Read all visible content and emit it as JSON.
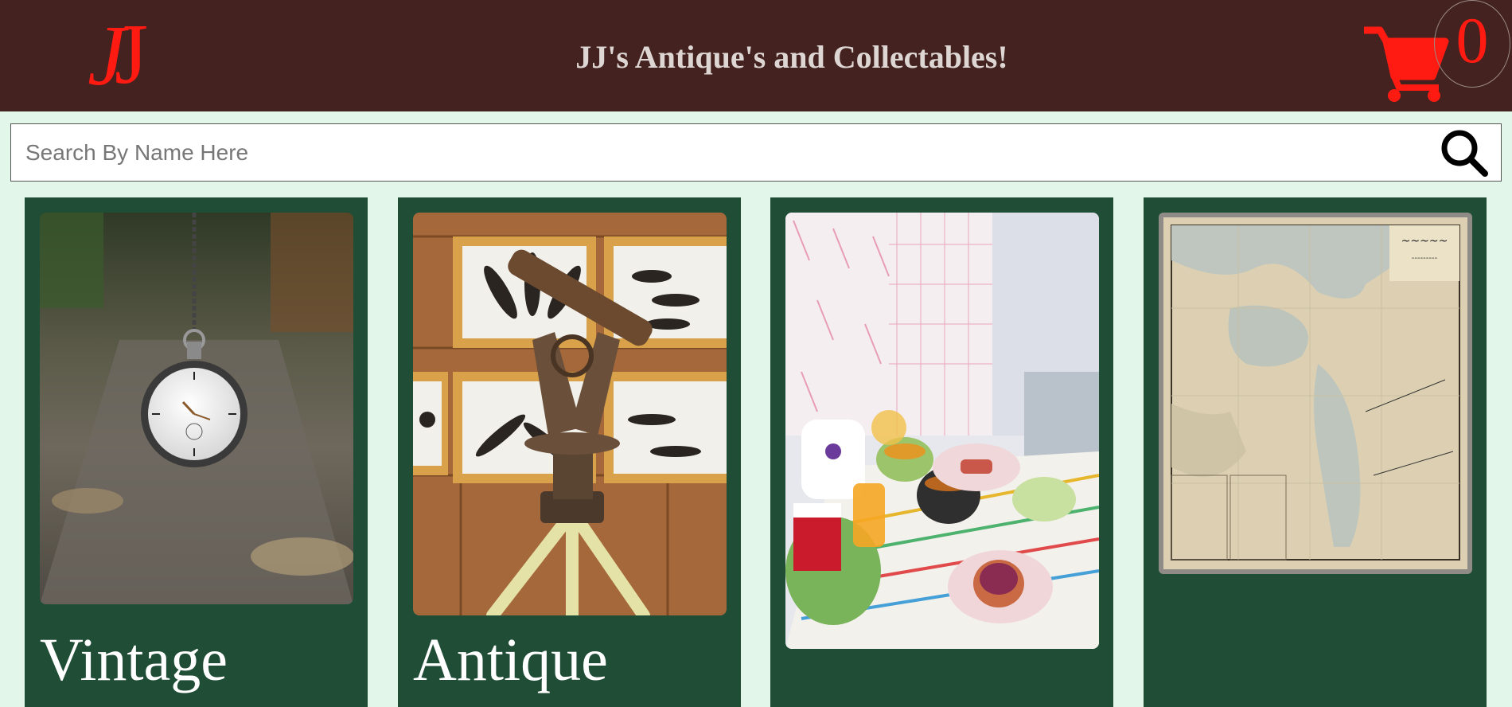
{
  "header": {
    "title": "JJ's Antique's and Collectables!",
    "logo_text": "JJ",
    "cart_icon": "shopping-cart-icon",
    "cart_count": "0"
  },
  "search": {
    "placeholder": "Search By Name Here",
    "value": "",
    "icon": "search-icon"
  },
  "products": [
    {
      "title": "Vintage",
      "image": "pocket-watch-photo"
    },
    {
      "title": "Antique",
      "image": "brass-theodolite-telescope-photo"
    },
    {
      "title": "",
      "image": "breakfast-table-tea-set-photo"
    },
    {
      "title": "",
      "image": "ottoman-map-middle-east-photo"
    }
  ],
  "colors": {
    "header_bg": "#432220",
    "page_bg": "#e2f7ea",
    "card_bg": "#204d36",
    "accent": "#ff1a12"
  }
}
